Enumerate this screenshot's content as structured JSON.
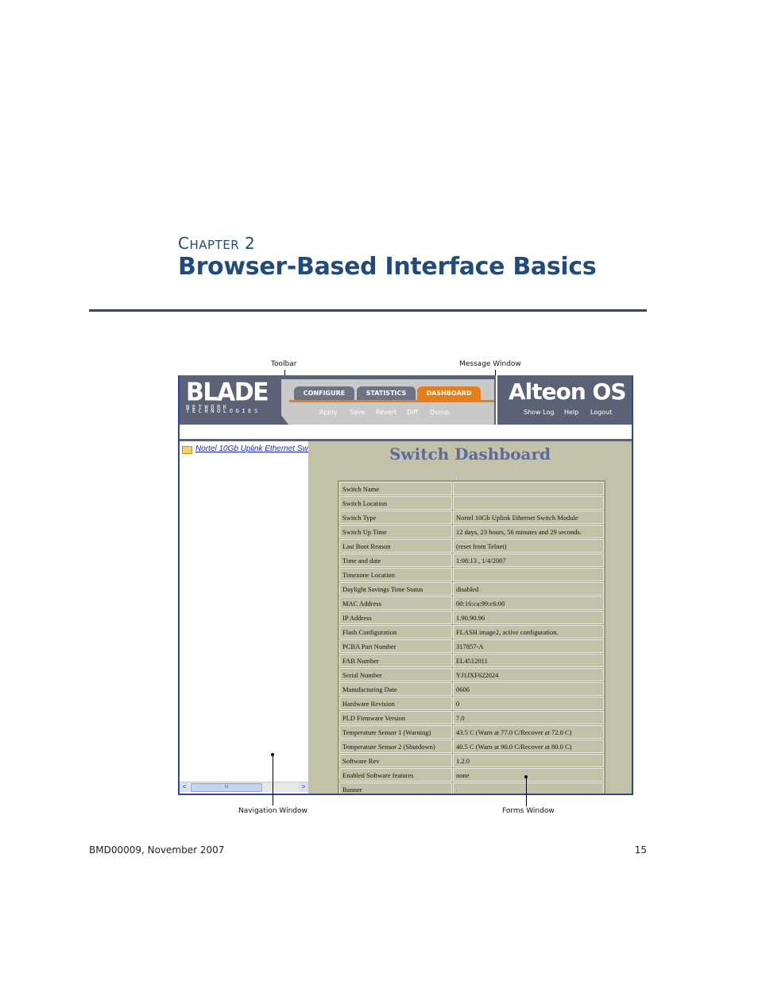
{
  "chapter": {
    "label_first": "C",
    "label_rest": "HAPTER",
    "number": "2",
    "title": "Browser-Based Interface Basics"
  },
  "callouts": {
    "toolbar": "Toolbar",
    "message_window": "Message Window",
    "navigation_window": "Navigation Window",
    "forms_window": "Forms Window"
  },
  "screenshot": {
    "logo_main": "BLADE",
    "logo_sub1": "NETWORK",
    "logo_sub2": "TECHNOLOGIES",
    "brand": "Alteon OS",
    "tabs": [
      "CONFIGURE",
      "STATISTICS",
      "DASHBOARD"
    ],
    "toolbar": [
      "Apply",
      "Save",
      "Revert",
      "Diff",
      "Dump"
    ],
    "right_toolbar": [
      "Show Log",
      "Help",
      "Logout"
    ],
    "nav_link": "Nortel 10Gb Uplink Ethernet Switch Module",
    "scroll_thumb": "III",
    "scroll_left": "<",
    "scroll_right": ">",
    "dashboard_title": "Switch Dashboard",
    "rows": [
      {
        "k": "Switch Name",
        "v": ""
      },
      {
        "k": "Switch Location",
        "v": ""
      },
      {
        "k": "Switch Type",
        "v": "Nortel 10Gb Uplink Ethernet Switch Module"
      },
      {
        "k": "Switch Up Time",
        "v": "12 days, 23 hours, 56 minutes and 29 seconds."
      },
      {
        "k": "Last Boot Reason",
        "v": " (reset from Telnet)"
      },
      {
        "k": "Time and date",
        "v": "1:08:13 , 1/4/2007"
      },
      {
        "k": "Timezone Location",
        "v": ""
      },
      {
        "k": "Daylight Savings Time Status",
        "v": "disabled"
      },
      {
        "k": "MAC Address",
        "v": "00:16:ca:99:c6:00"
      },
      {
        "k": "IP Address",
        "v": "1.90.90.96"
      },
      {
        "k": "Flash Configuration",
        "v": "FLASH image2, active configuration."
      },
      {
        "k": "PCBA Part Number",
        "v": "317857-A"
      },
      {
        "k": "FAB Number",
        "v": "EL4512011"
      },
      {
        "k": "Serial Number",
        "v": "YJ1JXF622024"
      },
      {
        "k": "Manufacturing Date",
        "v": "0606"
      },
      {
        "k": "Hardware Revision",
        "v": "0"
      },
      {
        "k": "PLD Firmware Version",
        "v": "7.0"
      },
      {
        "k": "Temperature Sensor 1 (Warning)",
        "v": "43.5 C (Warn at 77.0 C/Recover at 72.0 C)"
      },
      {
        "k": "Temperature Sensor 2 (Shutdown)",
        "v": "40.5 C (Warn at 90.0 C/Recover at 80.0 C)"
      },
      {
        "k": "Software Rev",
        "v": "1.2.0"
      },
      {
        "k": "Enabled Software features",
        "v": "none"
      },
      {
        "k": "Banner",
        "v": ""
      }
    ]
  },
  "footer": {
    "left": "BMD00009, November 2007",
    "page": "15"
  }
}
